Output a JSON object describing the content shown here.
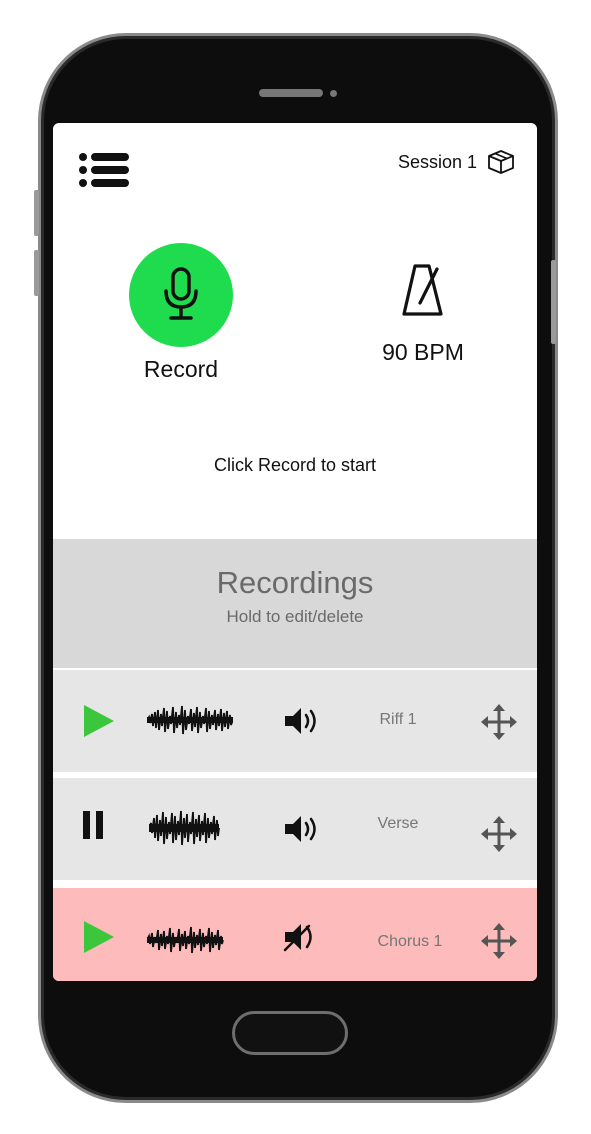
{
  "header": {
    "session_label": "Session 1",
    "menu_icon": "hamburger-list-icon",
    "session_icon": "box-icon"
  },
  "record": {
    "label": "Record",
    "color": "#1fdc4e",
    "icon": "microphone-icon"
  },
  "metronome": {
    "bpm_label": "90 BPM",
    "icon": "metronome-icon"
  },
  "hint": "Click Record to start",
  "recordings": {
    "title": "Recordings",
    "subtitle": "Hold to edit/delete",
    "items": [
      {
        "name": "Riff 1",
        "state": "stopped",
        "muted": false,
        "highlighted": false
      },
      {
        "name": "Verse",
        "state": "playing",
        "muted": false,
        "highlighted": false
      },
      {
        "name": "Chorus 1",
        "state": "stopped",
        "muted": true,
        "highlighted": true
      }
    ]
  },
  "colors": {
    "accent_green": "#1fdc4e",
    "play_green": "#3cc63c",
    "highlight_row": "#fdbbbb",
    "row_bg": "#e6e6e6"
  }
}
